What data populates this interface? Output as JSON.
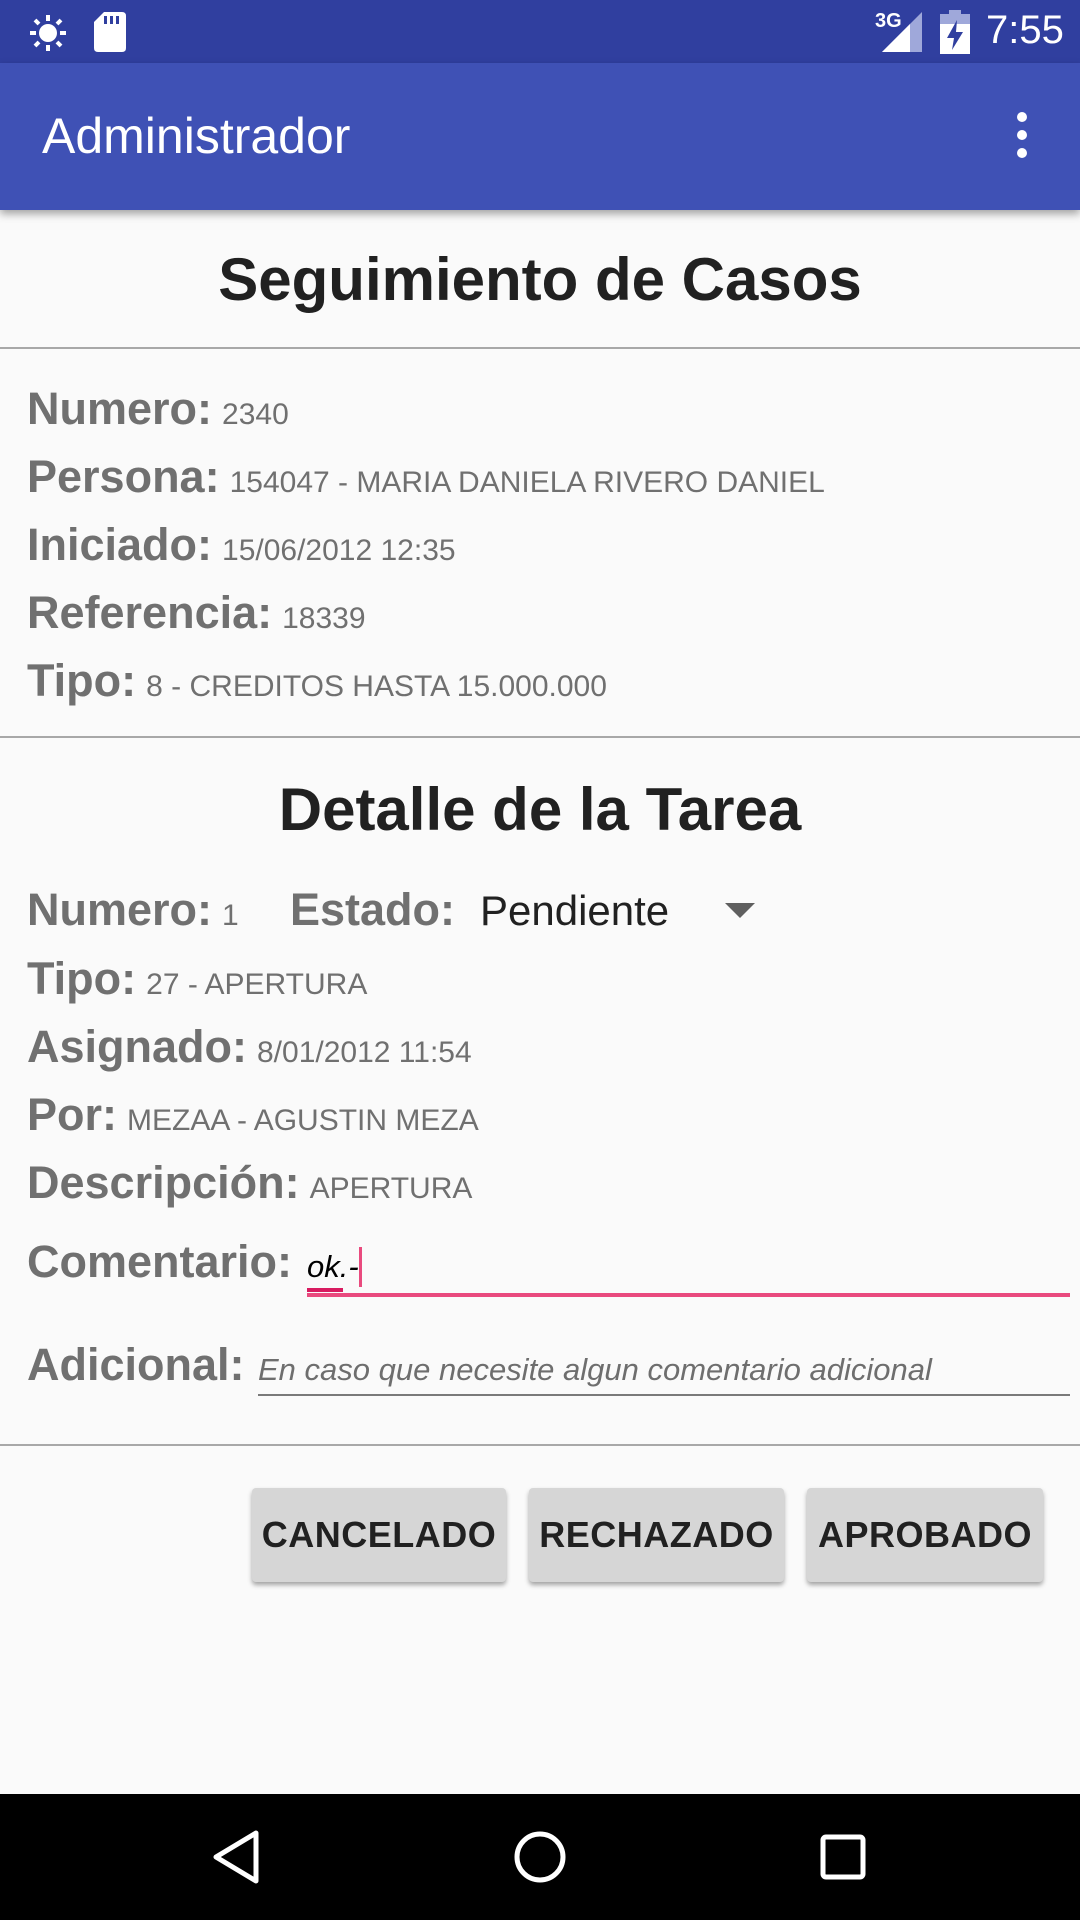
{
  "status_bar": {
    "network": "3G",
    "time": "7:55",
    "icons": [
      "brightness-icon",
      "sd-card-icon",
      "signal-icon",
      "battery-charging-icon"
    ]
  },
  "app_bar": {
    "title": "Administrador",
    "overflow_icon": "more-vert-icon"
  },
  "case_section": {
    "heading": "Seguimiento de Casos",
    "fields": [
      {
        "label": "Numero:",
        "value": "2340"
      },
      {
        "label": "Persona:",
        "value": "154047 - MARIA DANIELA RIVERO DANIEL"
      },
      {
        "label": "Iniciado:",
        "value": "15/06/2012 12:35"
      },
      {
        "label": "Referencia:",
        "value": "18339"
      },
      {
        "label": "Tipo:",
        "value": "8 - CREDITOS HASTA 15.000.000"
      }
    ]
  },
  "task_section": {
    "heading": "Detalle de la Tarea",
    "numero": {
      "label": "Numero:",
      "value": "1"
    },
    "estado": {
      "label": "Estado:",
      "selected": "Pendiente"
    },
    "fields": [
      {
        "label": "Tipo:",
        "value": "27 - APERTURA"
      },
      {
        "label": "Asignado:",
        "value": "8/01/2012 11:54"
      },
      {
        "label": "Por:",
        "value": "MEZAA - AGUSTIN MEZA"
      },
      {
        "label": "Descripción:",
        "value": "APERTURA"
      }
    ],
    "comentario": {
      "label": "Comentario:",
      "value": "ok.-"
    },
    "adicional": {
      "label": "Adicional:",
      "placeholder": "En caso que necesite algun comentario adicional"
    }
  },
  "buttons": {
    "cancel": "CANCELADO",
    "reject": "RECHAZADO",
    "approve": "APROBADO"
  },
  "colors": {
    "status_bar": "#303f9f",
    "app_bar": "#3f51b5",
    "accent": "#e94a7e"
  }
}
